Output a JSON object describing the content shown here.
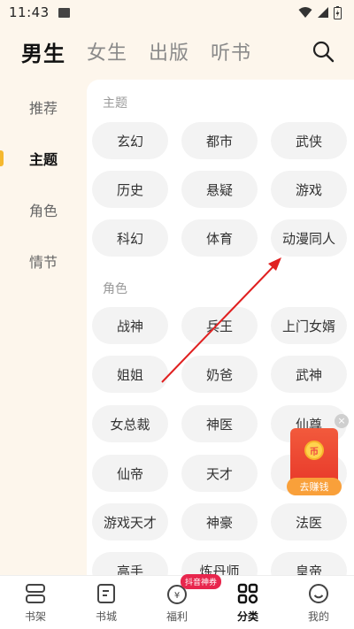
{
  "status_bar": {
    "time": "11:43"
  },
  "top_tabs": [
    {
      "label": "男生",
      "active": true
    },
    {
      "label": "女生",
      "active": false
    },
    {
      "label": "出版",
      "active": false
    },
    {
      "label": "听书",
      "active": false
    }
  ],
  "side_nav": [
    {
      "label": "推荐",
      "active": false
    },
    {
      "label": "主题",
      "active": true
    },
    {
      "label": "角色",
      "active": false
    },
    {
      "label": "情节",
      "active": false
    }
  ],
  "sections": {
    "theme": {
      "title": "主题",
      "chips": [
        "玄幻",
        "都市",
        "武侠",
        "历史",
        "悬疑",
        "游戏",
        "科幻",
        "体育",
        "动漫同人"
      ]
    },
    "role": {
      "title": "角色",
      "chips": [
        "战神",
        "兵王",
        "上门女婿",
        "姐姐",
        "奶爸",
        "武神",
        "女总裁",
        "神医",
        "仙尊",
        "仙帝",
        "天才",
        "",
        "游戏天才",
        "神豪",
        "法医",
        "高手",
        "炼丹师",
        "皇帝"
      ]
    }
  },
  "float_packet": {
    "label": "去赚钱",
    "coin": "币"
  },
  "bottom_nav": [
    {
      "label": "书架",
      "icon": "bookshelf-icon"
    },
    {
      "label": "书城",
      "icon": "bookstore-icon"
    },
    {
      "label": "福利",
      "icon": "welfare-icon",
      "badge": "抖音神券"
    },
    {
      "label": "分类",
      "icon": "category-icon",
      "active": true
    },
    {
      "label": "我的",
      "icon": "profile-icon"
    }
  ],
  "colors": {
    "accent": "#f5b82e",
    "arrow": "#e02020",
    "badge": "#e8264d"
  }
}
